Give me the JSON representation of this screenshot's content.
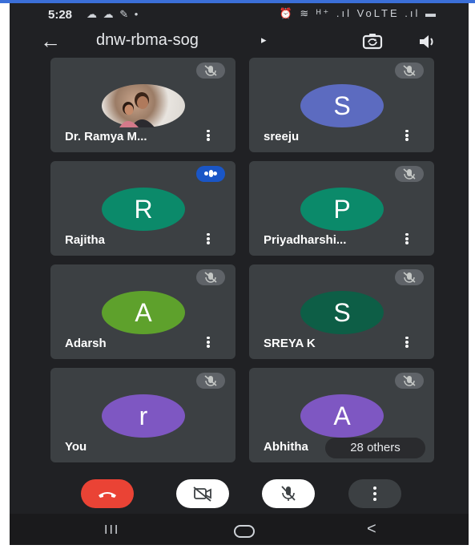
{
  "status_bar": {
    "time": "5:28",
    "left_icons": "☁ ☁ ✎ •",
    "right_icons": "⏰ ≋ ᴴ⁺ .ıl VoLTE .ıl ▬"
  },
  "app_bar": {
    "title": "dnw-rbma-sog",
    "title_arrow": "▸",
    "back_icon": "←"
  },
  "participants": [
    {
      "name": "Dr. Ramya M...",
      "initial": "",
      "color": "",
      "status": "muted",
      "avatar_type": "photo"
    },
    {
      "name": "sreeju",
      "initial": "S",
      "color": "#5c6bc0",
      "status": "muted",
      "avatar_type": "initial"
    },
    {
      "name": "Rajitha",
      "initial": "R",
      "color": "#0b8a6a",
      "status": "speaking",
      "avatar_type": "initial"
    },
    {
      "name": "Priyadharshi...",
      "initial": "P",
      "color": "#0b8a6a",
      "status": "muted",
      "avatar_type": "initial"
    },
    {
      "name": "Adarsh",
      "initial": "A",
      "color": "#5ea12c",
      "status": "muted",
      "avatar_type": "initial"
    },
    {
      "name": "SREYA K",
      "initial": "S",
      "color": "#0d5e46",
      "status": "muted",
      "avatar_type": "initial"
    },
    {
      "name": "You",
      "initial": "r",
      "color": "#7e57c2",
      "status": "muted",
      "avatar_type": "initial"
    },
    {
      "name": "Abhitha",
      "initial": "A",
      "color": "#7e57c2",
      "status": "muted",
      "avatar_type": "initial"
    }
  ],
  "others_label": "28 others",
  "controls": {
    "end_call_color": "#ea4335",
    "camera_state": "off",
    "mic_state": "muted"
  },
  "nav_bar": {
    "recents": "III",
    "back": "<"
  }
}
